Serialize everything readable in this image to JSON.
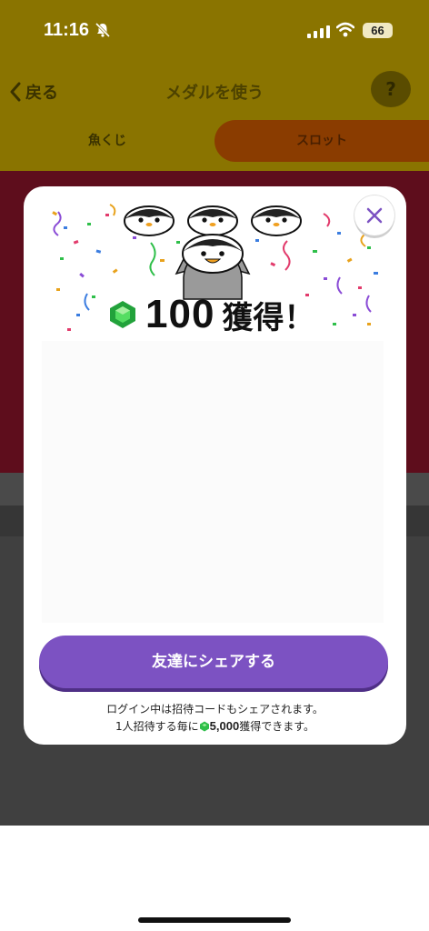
{
  "status_bar": {
    "time": "11:16",
    "battery": "66"
  },
  "header": {
    "back_label": "戻る",
    "title": "メダルを使う",
    "help_label": "?"
  },
  "tabs": [
    {
      "label": "魚くじ"
    },
    {
      "label": "スロット"
    }
  ],
  "modal": {
    "reward_amount": "100",
    "reward_word": "獲得！",
    "share_button": "友達にシェアする",
    "note_line1": "ログイン中は招待コードもシェアされます。",
    "note_line2_prefix": "1人招待する毎に",
    "note_line2_amount": "5,000",
    "note_line2_suffix": "獲得できます。"
  },
  "colors": {
    "accent_purple": "#7c52c2",
    "gem_green": "#2fbf4a",
    "header_dim": "#8a7400",
    "slot_tab_dim": "#8a3c00"
  }
}
